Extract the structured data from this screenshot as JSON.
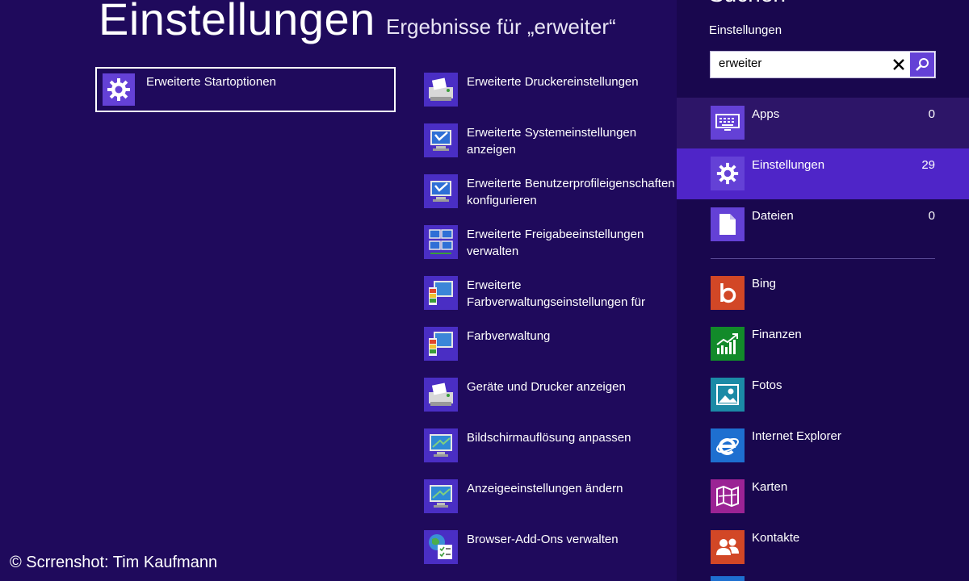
{
  "header": {
    "title": "Einstellungen",
    "results_text": "Ergebnisse für „erweiter“"
  },
  "selected_result": {
    "label": "Erweiterte Startoptionen",
    "icon": "gear-icon"
  },
  "results": [
    {
      "label": "Erweiterte Druckereinstellungen",
      "icon": "printer-icon"
    },
    {
      "label": "Erweiterte Systemeinstellungen anzeigen",
      "icon": "system-monitor-icon"
    },
    {
      "label": "Erweiterte Benutzerprofileigenschaften\nkonfigurieren",
      "icon": "system-monitor-icon"
    },
    {
      "label": "Erweiterte Freigabeeinstellungen verwalten",
      "icon": "network-icon"
    },
    {
      "label": "Erweiterte Farbverwaltungseinstellungen für\nBildschirme, Scanner und Drucker ändern",
      "icon": "color-management-icon"
    },
    {
      "label": "Farbverwaltung",
      "icon": "color-management-icon"
    },
    {
      "label": "Geräte und Drucker anzeigen",
      "icon": "printer-icon"
    },
    {
      "label": "Bildschirmauflösung anpassen",
      "icon": "display-icon"
    },
    {
      "label": "Anzeigeeinstellungen ändern",
      "icon": "display-icon"
    },
    {
      "label": "Browser-Add-Ons verwalten",
      "icon": "globe-checklist-icon"
    }
  ],
  "charm": {
    "heading": "Suchen",
    "scope_label": "Einstellungen",
    "search": {
      "value": "erweiter",
      "placeholder": ""
    },
    "scopes": [
      {
        "label": "Apps",
        "count": "0",
        "icon": "keyboard-icon",
        "selected": false
      },
      {
        "label": "Einstellungen",
        "count": "29",
        "icon": "gear-icon",
        "selected": true
      },
      {
        "label": "Dateien",
        "count": "0",
        "icon": "document-icon",
        "selected": false
      }
    ],
    "apps": [
      {
        "label": "Bing",
        "icon": "bing-icon",
        "color": "#d24726"
      },
      {
        "label": "Finanzen",
        "icon": "finance-chart-icon",
        "color": "#128a2a"
      },
      {
        "label": "Fotos",
        "icon": "photos-icon",
        "color": "#1b8aa6"
      },
      {
        "label": "Internet Explorer",
        "icon": "internet-explorer-icon",
        "color": "#1e6fd0"
      },
      {
        "label": "Karten",
        "icon": "map-icon",
        "color": "#9b2394"
      },
      {
        "label": "Kontakte",
        "icon": "people-icon",
        "color": "#d24726"
      }
    ]
  },
  "colors": {
    "background": "#1f0a5c",
    "charm_background": "#19074e",
    "accent": "#6441d6",
    "selected_scope": "#4f25c8",
    "hover_scope": "#2d1568"
  },
  "footer": {
    "copyright": "© Scrrenshot: Tim Kaufmann"
  }
}
